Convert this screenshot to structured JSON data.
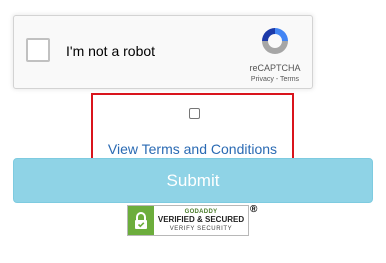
{
  "recaptcha": {
    "checkbox_label": "I'm not a robot",
    "brand": "reCAPTCHA",
    "privacy_link": "Privacy",
    "separator": "-",
    "terms_link": "Terms",
    "logo_icon": "recaptcha-logo-icon",
    "logo_colors": [
      "#1c3aa9",
      "#4285f4",
      "#a6a6a6"
    ]
  },
  "terms": {
    "link_text": "View Terms and Conditions",
    "checked": false,
    "highlight_color": "#d9141c"
  },
  "form": {
    "submit_label": "Submit",
    "submit_color": "#8fd3e6"
  },
  "seal": {
    "line1": "GODADDY",
    "line2": "VERIFIED & SECURED",
    "line3": "VERIFY SECURITY",
    "registered_mark": "®",
    "lock_icon": "lock-icon",
    "color": "#6cad3c"
  }
}
